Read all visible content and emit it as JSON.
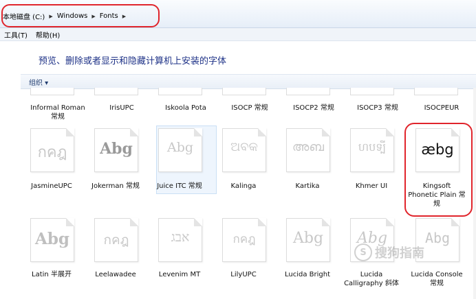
{
  "address": {
    "crumbs": [
      "本地磁盘 (C:)",
      "Windows",
      "Fonts"
    ]
  },
  "menu": {
    "tools": "工具(T)",
    "help": "帮助(H)"
  },
  "header": "预览、删除或者显示和隐藏计算机上安装的字体",
  "toolbar": {
    "organize": "组织 ▾"
  },
  "rows": [
    {
      "fonts": [
        {
          "name": "Informal Roman 常规"
        },
        {
          "name": "IrisUPC"
        },
        {
          "name": "Iskoola Pota"
        },
        {
          "name": "ISOCP 常规"
        },
        {
          "name": "ISOCP2 常规"
        },
        {
          "name": "ISOCP3 常规"
        },
        {
          "name": "ISOCPEUR"
        }
      ]
    },
    {
      "fonts": [
        {
          "name": "JasmineUPC",
          "sample": "กคฎ"
        },
        {
          "name": "Jokerman 常规",
          "sample": "Abg"
        },
        {
          "name": "Juice ITC 常规",
          "sample": "Abg"
        },
        {
          "name": "Kalinga",
          "sample": "ଅବକ"
        },
        {
          "name": "Kartika",
          "sample": "അബ"
        },
        {
          "name": "Khmer UI",
          "sample": "ហបទ្បី"
        },
        {
          "name": "Kingsoft Phonetic Plain 常规",
          "sample": "æbg"
        }
      ]
    },
    {
      "fonts": [
        {
          "name": "Latin 半展开",
          "sample": "Abg"
        },
        {
          "name": "Leelawadee",
          "sample": "กคฎ"
        },
        {
          "name": "Levenim MT",
          "sample": "אבג"
        },
        {
          "name": "LilyUPC",
          "sample": "กคฎ"
        },
        {
          "name": "Lucida Bright",
          "sample": "Abg"
        },
        {
          "name": "Lucida Calligraphy 斜体",
          "sample": "Abg"
        },
        {
          "name": "Lucida Console 常规",
          "sample": "Abg"
        }
      ]
    }
  ],
  "watermark": {
    "logo": "S",
    "text": "搜狗指南"
  }
}
